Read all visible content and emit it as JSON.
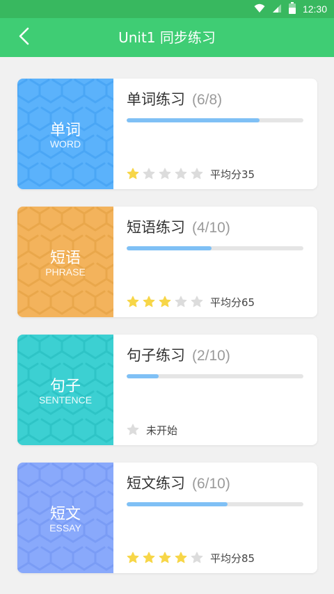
{
  "status_bar": {
    "time": "12:30",
    "icons": [
      "wifi-icon",
      "signal-icon",
      "battery-icon"
    ]
  },
  "header": {
    "title": "Unit1 同步练习",
    "back_icon": "chevron-left-icon"
  },
  "colors": {
    "header": "#3fcd74",
    "status_bar": "#38b85f",
    "progress": "#7fc0f5",
    "star_on": "#f7d648",
    "star_off": "#dcdcdc"
  },
  "cards": [
    {
      "id": "word",
      "cn": "单词",
      "en": "WORD",
      "title": "单词练习",
      "count": "(6/8)",
      "progress": 0.75,
      "stars": 1,
      "status": "平均分35",
      "color": "#5bb2fb",
      "pattern_color": "#4aa6f5"
    },
    {
      "id": "phrase",
      "cn": "短语",
      "en": "PHRASE",
      "title": "短语练习",
      "count": "(4/10)",
      "progress": 0.48,
      "stars": 3,
      "status": "平均分65",
      "color": "#f3b35c",
      "pattern_color": "#e9a74b"
    },
    {
      "id": "sentence",
      "cn": "句子",
      "en": "SENTENCE",
      "title": "句子练习",
      "count": "(2/10)",
      "progress": 0.18,
      "stars": 0,
      "star_slots": 1,
      "status": "未开始",
      "color": "#3cd0d2",
      "pattern_color": "#2ec4c6"
    },
    {
      "id": "essay",
      "cn": "短文",
      "en": "ESSAY",
      "title": "短文练习",
      "count": "(6/10)",
      "progress": 0.57,
      "stars": 4,
      "status": "平均分85",
      "color": "#89a9fb",
      "pattern_color": "#7a9cf5"
    }
  ]
}
